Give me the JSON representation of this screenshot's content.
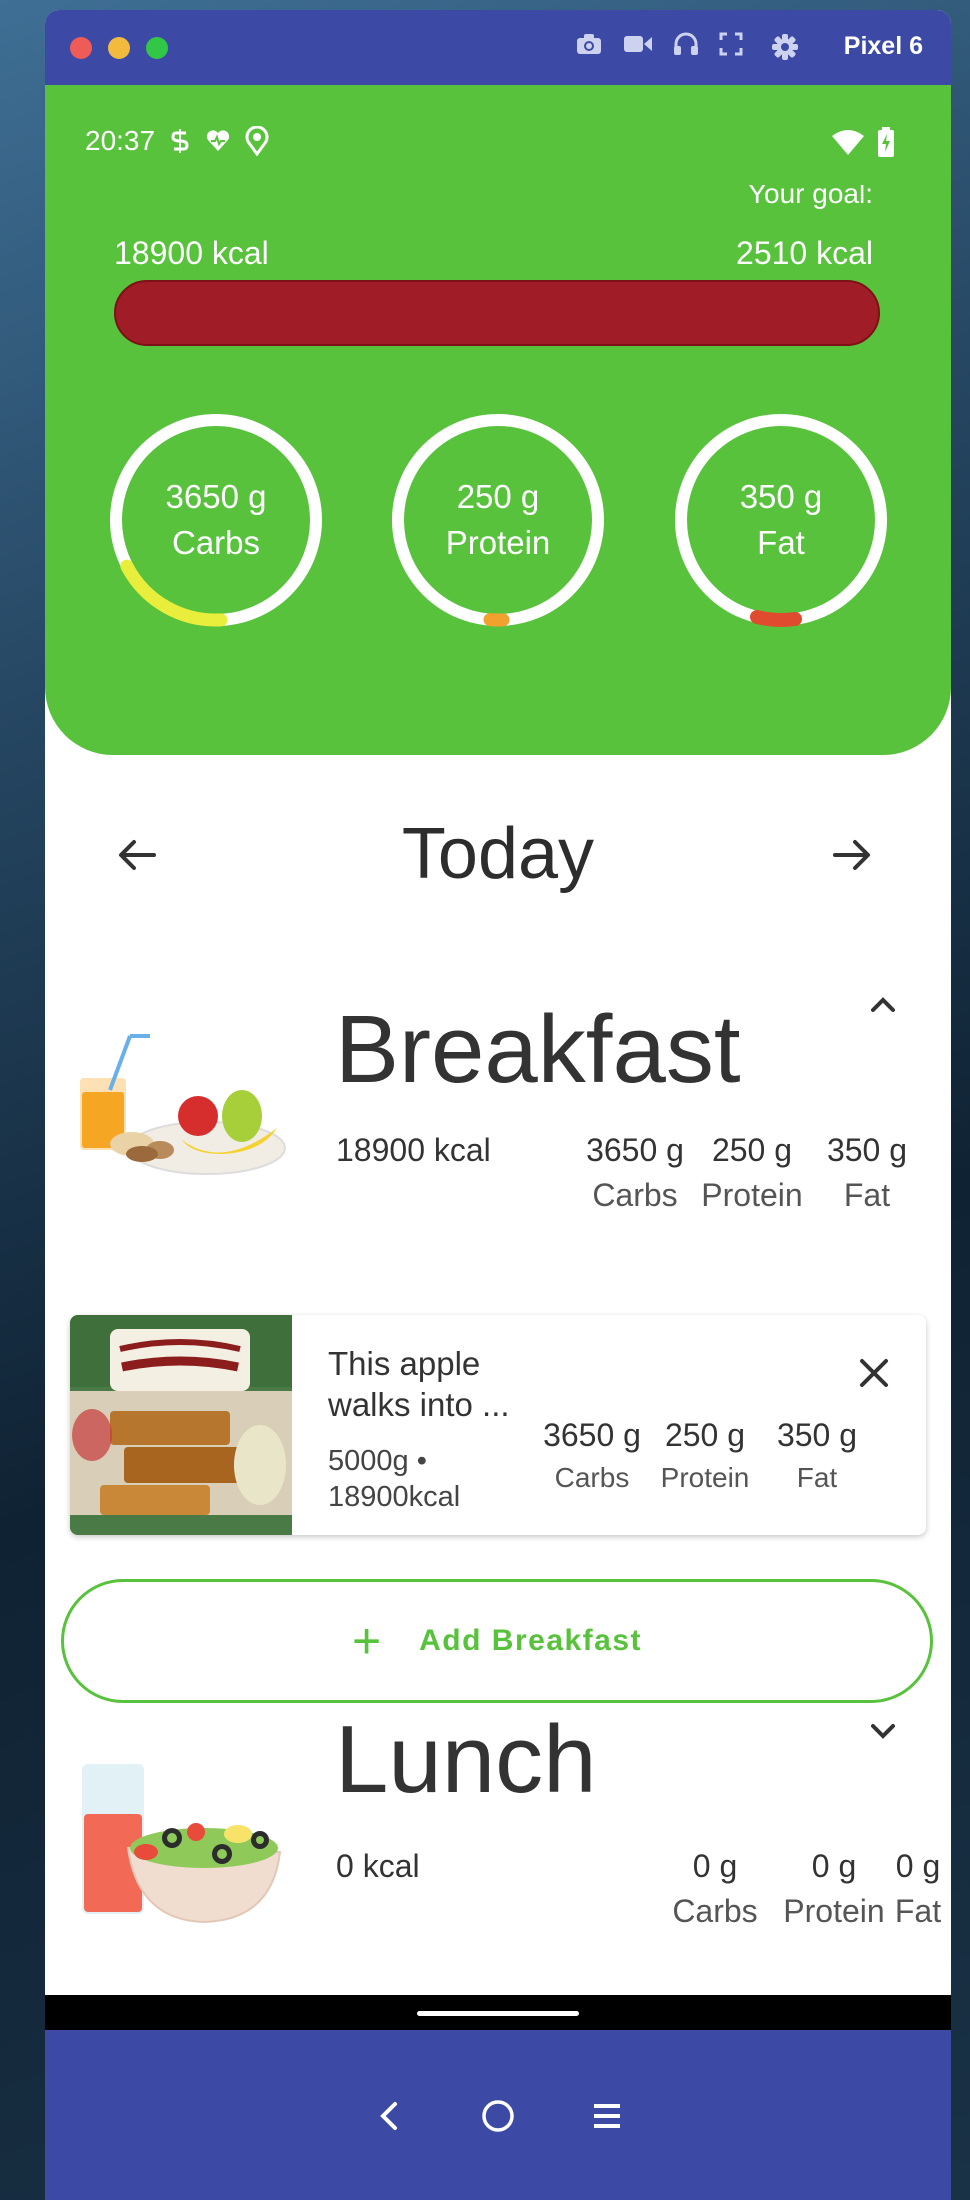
{
  "window": {
    "device_name": "Pixel 6"
  },
  "status": {
    "time": "20:37"
  },
  "summary": {
    "consumed": "18900 kcal",
    "goal_label": "Your goal:",
    "goal": "2510 kcal",
    "bar_fill_fraction": 1.0,
    "colors": {
      "hero": "#58c23c",
      "bar": "#a01d27",
      "carbs_arc": "#e9ee3c",
      "protein_arc": "#f2a12f",
      "fat_arc": "#e04a2e"
    }
  },
  "rings": [
    {
      "value": "3650 g",
      "label": "Carbs"
    },
    {
      "value": "250 g",
      "label": "Protein"
    },
    {
      "value": "350 g",
      "label": "Fat"
    }
  ],
  "day": {
    "title": "Today"
  },
  "breakfast": {
    "title": "Breakfast",
    "kcal": "18900 kcal",
    "macros": [
      {
        "value": "3650 g",
        "label": "Carbs"
      },
      {
        "value": "250 g",
        "label": "Protein"
      },
      {
        "value": "350 g",
        "label": "Fat"
      }
    ],
    "entry": {
      "name": "This apple walks into ...",
      "amount": "5000g •",
      "kcal": "18900kcal",
      "macros": [
        {
          "value": "3650 g",
          "label": "Carbs"
        },
        {
          "value": "250 g",
          "label": "Protein"
        },
        {
          "value": "350 g",
          "label": "Fat"
        }
      ]
    },
    "add_label": "Add Breakfast"
  },
  "lunch": {
    "title": "Lunch",
    "kcal": "0 kcal",
    "macros": [
      {
        "value": "0 g",
        "label": "Carbs"
      },
      {
        "value": "0 g",
        "label": "Protein"
      },
      {
        "value": "0 g",
        "label": "Fat"
      }
    ]
  }
}
